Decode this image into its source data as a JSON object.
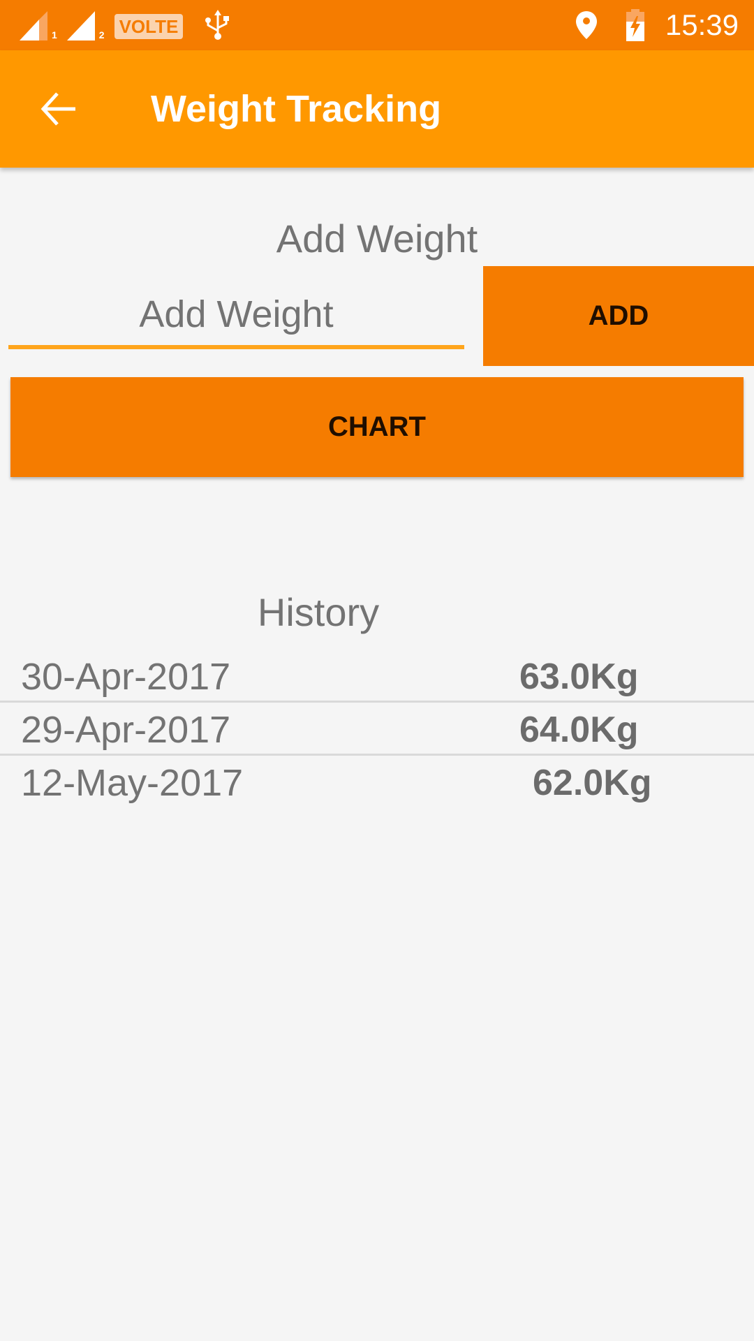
{
  "status_bar": {
    "sim1_label": "1",
    "sim2_label": "2",
    "volte_label": "VOLTE",
    "time": "15:39",
    "icons": [
      "signal-sim1-icon",
      "signal-sim2-icon",
      "volte-icon",
      "usb-icon",
      "location-icon",
      "battery-charging-icon"
    ]
  },
  "app_bar": {
    "title": "Weight Tracking",
    "back_icon": "arrow-back-icon"
  },
  "add_section": {
    "heading": "Add Weight",
    "input_value": "",
    "input_placeholder": "Add Weight",
    "add_button_label": "ADD",
    "chart_button_label": "CHART"
  },
  "history": {
    "heading": "History",
    "entries": [
      {
        "date": "30-Apr-2017",
        "weight": "63.0Kg"
      },
      {
        "date": "29-Apr-2017",
        "weight": "64.0Kg"
      },
      {
        "date": "12-May-2017",
        "weight": "62.0Kg"
      }
    ]
  },
  "colors": {
    "status_bar": "#F57C00",
    "app_bar": "#FF9800",
    "button": "#F57C00",
    "accent_underline": "#FFA51C",
    "background": "#F5F5F5",
    "text_gray": "#737373"
  }
}
